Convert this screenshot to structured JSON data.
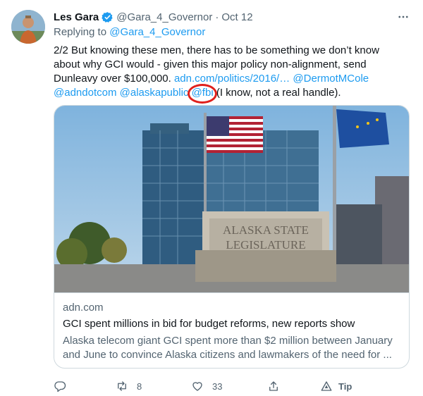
{
  "author": {
    "name": "Les Gara",
    "handle": "@Gara_4_Governor",
    "separator": "·",
    "date": "Oct 12"
  },
  "reply": {
    "prefix": "Replying to",
    "target": "@Gara_4_Governor"
  },
  "body": {
    "line1": "2/2 But knowing these men, there has to be something we don’t know",
    "line2": "about why GCI would - given this major policy non-alignment, send",
    "line3_text": "Dunleavy over $100,000.",
    "line3_link1": "adn.com/politics/2016/…",
    "line3_link2": "@DermotMCole",
    "line4_link1": "@adndotcom",
    "line4_link2": "@alaskapublic",
    "line4_link3": "@fbi",
    "line4_text": "(I know, not a real handle)."
  },
  "card": {
    "image_sign_line1": "ALASKA STATE",
    "image_sign_line2": "LEGISLATURE",
    "domain": "adn.com",
    "title": "GCI spent millions in bid for budget reforms, new reports show",
    "description": "Alaska telecom giant GCI spent more than $2 million between January and June to convince Alaska citizens and lawmakers of the need for ..."
  },
  "actions": {
    "reply_count": "",
    "retweet_count": "8",
    "like_count": "33",
    "tip_label": "Tip"
  },
  "colors": {
    "link": "#1d9bf0",
    "secondary_text": "#536471",
    "annotation_circle": "#e0201c",
    "verified": "#1d9bf0"
  },
  "icons": [
    "verified-badge-icon",
    "more-icon",
    "reply-icon",
    "retweet-icon",
    "like-icon",
    "share-icon",
    "tip-icon"
  ]
}
